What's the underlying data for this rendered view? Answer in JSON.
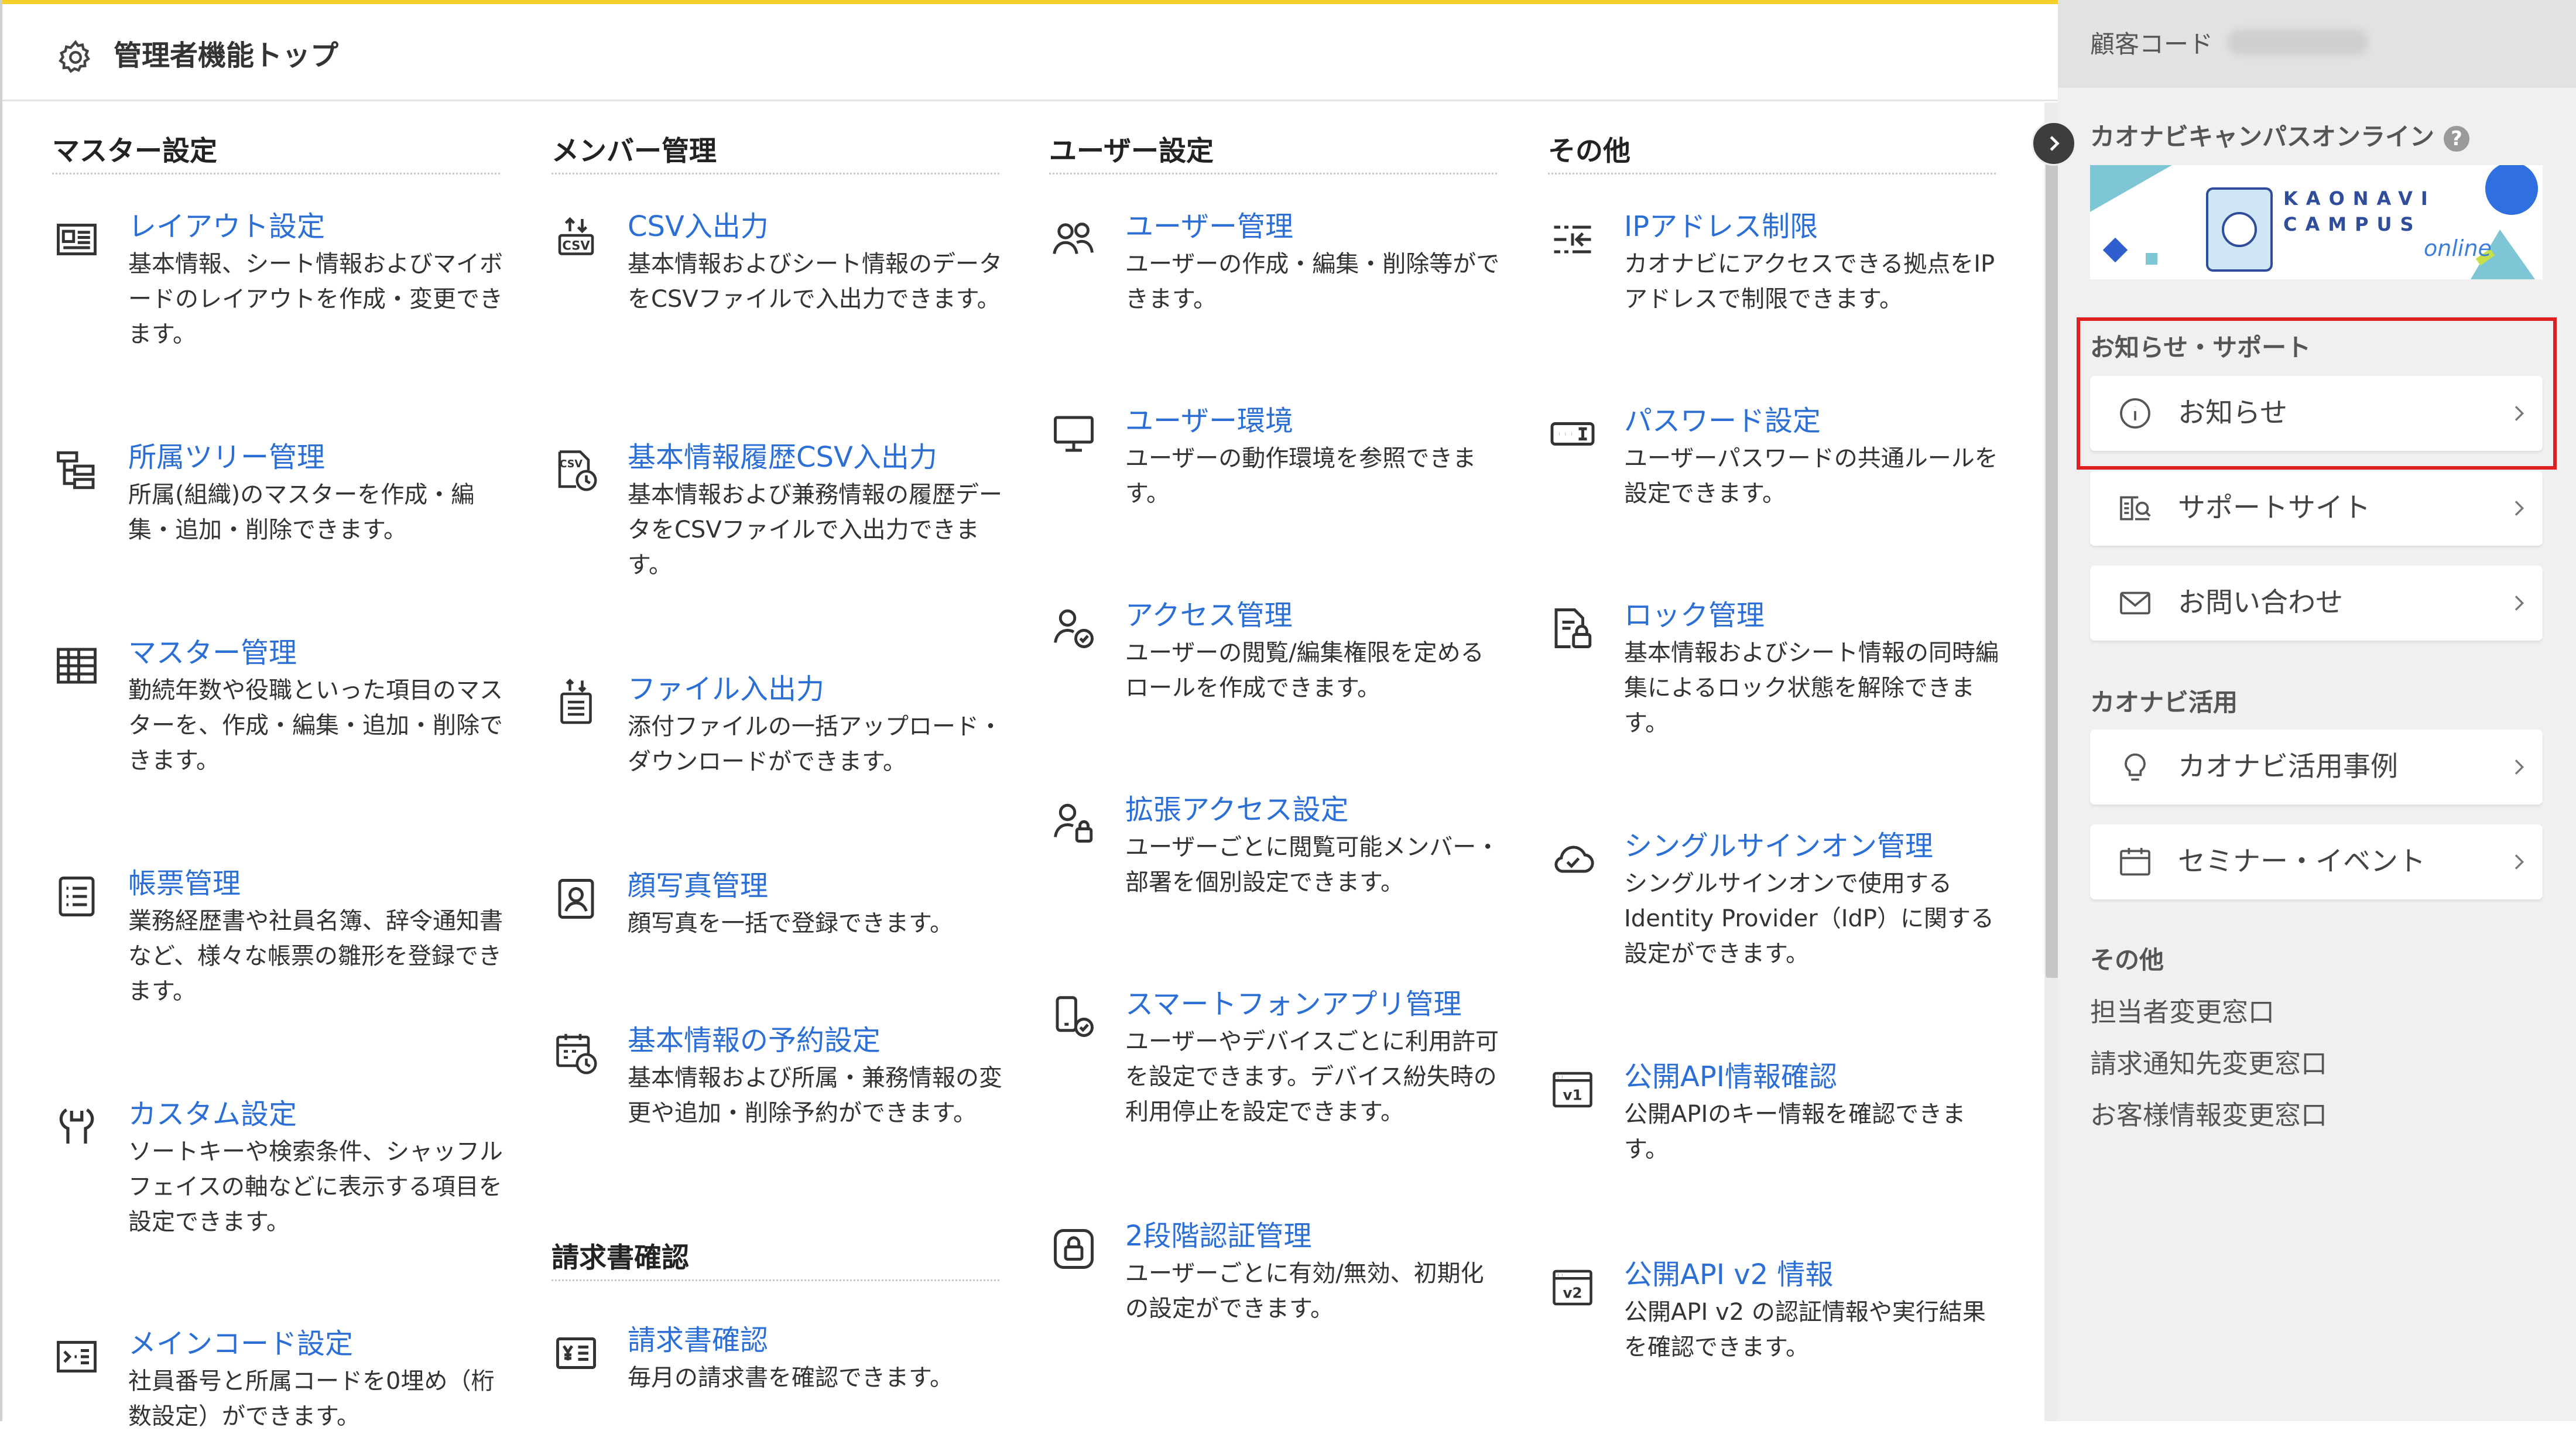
{
  "header": {
    "title": "管理者機能トップ"
  },
  "columns": [
    {
      "heading": "マスター設定",
      "items": [
        {
          "title": "レイアウト設定",
          "desc": "基本情報、シート情報およびマイボードのレイアウトを作成・変更できます。",
          "icon": "layout-icon"
        },
        {
          "title": "所属ツリー管理",
          "desc": "所属(組織)のマスターを作成・編集・追加・削除できます。",
          "icon": "tree-icon"
        },
        {
          "title": "マスター管理",
          "desc": "勤続年数や役職といった項目のマスターを、作成・編集・追加・削除できます。",
          "icon": "table-icon"
        },
        {
          "title": "帳票管理",
          "desc": "業務経歴書や社員名簿、辞令通知書など、様々な帳票の雛形を登録できます。",
          "icon": "list-document-icon"
        },
        {
          "title": "カスタム設定",
          "desc": "ソートキーや検索条件、シャッフルフェイスの軸などに表示する項目を設定できます。",
          "icon": "wrench-icon"
        },
        {
          "title": "メインコード設定",
          "desc": "社員番号と所属コードを0埋め（桁数設定）ができます。",
          "icon": "code-icon"
        }
      ]
    },
    {
      "heading": "メンバー管理",
      "items": [
        {
          "title": "CSV入出力",
          "desc": "基本情報およびシート情報のデータをCSVファイルで入出力できます。",
          "icon": "csv-icon"
        },
        {
          "title": "基本情報履歴CSV入出力",
          "desc": "基本情報および兼務情報の履歴データをCSVファイルで入出力できます。",
          "icon": "csv-history-icon"
        },
        {
          "title": "ファイル入出力",
          "desc": "添付ファイルの一括アップロード・ダウンロードができます。",
          "icon": "file-transfer-icon"
        },
        {
          "title": "顔写真管理",
          "desc": "顔写真を一括で登録できます。",
          "icon": "portrait-icon"
        },
        {
          "title": "基本情報の予約設定",
          "desc": "基本情報および所属・兼務情報の変更や追加・削除予約ができます。",
          "icon": "calendar-clock-icon"
        }
      ],
      "subheading": "請求書確認",
      "subitems": [
        {
          "title": "請求書確認",
          "desc": "毎月の請求書を確認できます。",
          "icon": "invoice-icon"
        }
      ]
    },
    {
      "heading": "ユーザー設定",
      "items": [
        {
          "title": "ユーザー管理",
          "desc": "ユーザーの作成・編集・削除等ができます。",
          "icon": "users-icon"
        },
        {
          "title": "ユーザー環境",
          "desc": "ユーザーの動作環境を参照できます。",
          "icon": "monitor-icon"
        },
        {
          "title": "アクセス管理",
          "desc": "ユーザーの閲覧/編集権限を定めるロールを作成できます。",
          "icon": "user-check-icon"
        },
        {
          "title": "拡張アクセス設定",
          "desc": "ユーザーごとに閲覧可能メンバー・部署を個別設定できます。",
          "icon": "user-lock-icon"
        },
        {
          "title": "スマートフォンアプリ管理",
          "desc": "ユーザーやデバイスごとに利用許可を設定できます。デバイス紛失時の利用停止を設定できます。",
          "icon": "smartphone-check-icon"
        },
        {
          "title": "2段階認証管理",
          "desc": "ユーザーごとに有効/無効、初期化の設定ができます。",
          "icon": "two-factor-icon"
        }
      ]
    },
    {
      "heading": "その他",
      "items": [
        {
          "title": "IPアドレス制限",
          "desc": "カオナビにアクセスできる拠点をIPアドレスで制限できます。",
          "icon": "ip-restrict-icon"
        },
        {
          "title": "パスワード設定",
          "desc": "ユーザーパスワードの共通ルールを設定できます。",
          "icon": "password-icon"
        },
        {
          "title": "ロック管理",
          "desc": "基本情報およびシート情報の同時編集によるロック状態を解除できます。",
          "icon": "file-lock-icon"
        },
        {
          "title": "シングルサインオン管理",
          "desc": "シングルサインオンで使用するIdentity Provider（IdP）に関する設定ができます。",
          "icon": "cloud-check-icon"
        },
        {
          "title": "公開API情報確認",
          "desc": "公開APIのキー情報を確認できます。",
          "icon": "api-v1-icon"
        },
        {
          "title": "公開API v2 情報",
          "desc": "公開API v2 の認証情報や実行結果を確認できます。",
          "icon": "api-v2-icon"
        }
      ]
    }
  ],
  "sidebar": {
    "customer_label": "顧客コード",
    "campus_heading": "カオナビキャンパスオンライン",
    "banner_logo_line1": "KAONAVI",
    "banner_logo_line2": "CAMPUS",
    "banner_sub": "online",
    "news_heading": "お知らせ・サポート",
    "cards_support": [
      {
        "label": "お知らせ",
        "icon": "info-icon"
      },
      {
        "label": "サポートサイト",
        "icon": "support-book-icon"
      },
      {
        "label": "お問い合わせ",
        "icon": "mail-icon"
      }
    ],
    "usage_heading": "カオナビ活用",
    "cards_usage": [
      {
        "label": "カオナビ活用事例",
        "icon": "lightbulb-icon"
      },
      {
        "label": "セミナー・イベント",
        "icon": "calendar-icon"
      }
    ],
    "other_heading": "その他",
    "links": [
      "担当者変更窓口",
      "請求通知先変更窓口",
      "お客様情報変更窓口"
    ]
  },
  "colors": {
    "accent_line": "#f6cf2a",
    "link": "#2b6fd6",
    "highlight": "#e02020"
  }
}
